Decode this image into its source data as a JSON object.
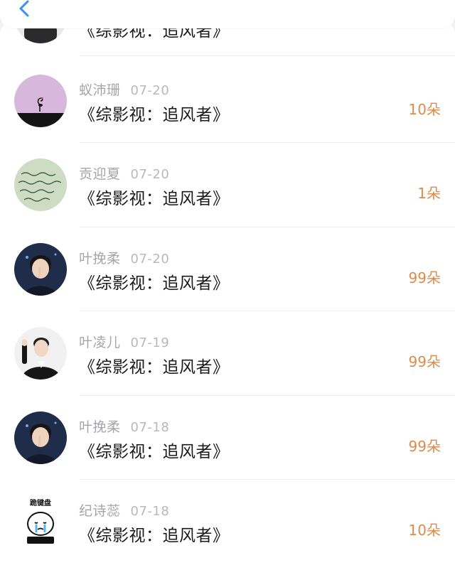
{
  "header": {
    "back_icon": "chevron-left-icon",
    "accent": "#3b8ff3"
  },
  "partial_row": {
    "title": "《综影视：追风者》"
  },
  "records": [
    {
      "name": "蚁沛珊",
      "date": "07-20",
      "title": "《综影视：追风者》",
      "amount": "10朵",
      "avatar": "flamingo-silhouette-avatar"
    },
    {
      "name": "贡迎夏",
      "date": "07-20",
      "title": "《综影视：追风者》",
      "amount": "1朵",
      "avatar": "handwritten-note-avatar"
    },
    {
      "name": "叶挽柔",
      "date": "07-20",
      "title": "《综影视：追风者》",
      "amount": "99朵",
      "avatar": "portrait-finger-lips-avatar"
    },
    {
      "name": "叶凌儿",
      "date": "07-19",
      "title": "《综影视：追风者》",
      "amount": "99朵",
      "avatar": "portrait-tuxedo-wave-avatar"
    },
    {
      "name": "叶挽柔",
      "date": "07-18",
      "title": "《综影视：追风者》",
      "amount": "99朵",
      "avatar": "portrait-finger-lips-avatar"
    },
    {
      "name": "纪诗蕊",
      "date": "07-18",
      "title": "《综影视：追风者》",
      "amount": "10朵",
      "avatar": "crying-cartoon-avatar"
    }
  ],
  "avatar_texts": {
    "cartoon_caption": "跪键盘"
  },
  "colors": {
    "amount": "#de8a4a",
    "name": "#a5a5aa",
    "title": "#1a1a1a"
  }
}
